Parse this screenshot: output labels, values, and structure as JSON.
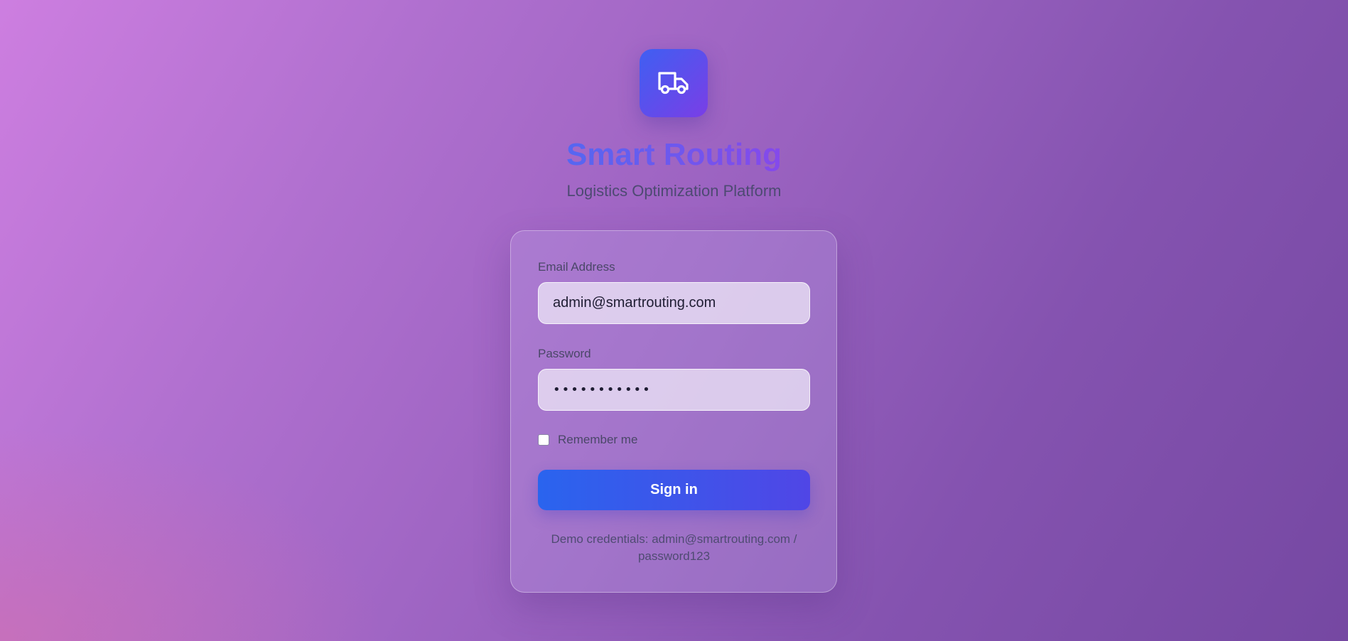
{
  "brand": {
    "logo_icon": "truck-icon",
    "title": "Smart Routing",
    "subtitle": "Logistics Optimization Platform"
  },
  "form": {
    "email_label": "Email Address",
    "email_value": "admin@smartrouting.com",
    "password_label": "Password",
    "password_value": "password123",
    "remember_label": "Remember me",
    "remember_checked": false,
    "signin_label": "Sign in",
    "demo_text": "Demo credentials: admin@smartrouting.com / password123"
  },
  "colors": {
    "accent_blue": "#2a64ee",
    "accent_purple": "#5046e6",
    "title_gradient_start": "#4f6bf2",
    "title_gradient_end": "#8b45ea"
  }
}
